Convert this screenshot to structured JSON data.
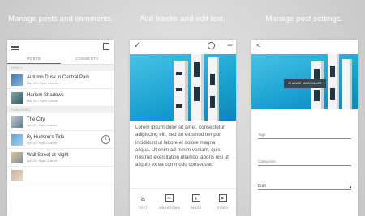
{
  "captions": {
    "left": "Manage posts and comments.",
    "center": "Add blocks and edit text.",
    "right": "Manage post settings."
  },
  "posts_screen": {
    "tabs": [
      "POSTS",
      "COMMENTS"
    ],
    "active_tab": "POSTS",
    "sections": {
      "draft": "DRAFT",
      "published": "PUBLISHED"
    },
    "drafts": [
      {
        "title": "Autumn Dusk in Central Park",
        "meta": "May 26 • Ryan Gushiel"
      },
      {
        "title": "Harlem Shadows",
        "meta": "May 26 • Ryan Gushiel"
      }
    ],
    "published": [
      {
        "title": "The City",
        "meta": "Apr 10 • Ryan Gushiel"
      },
      {
        "title": "By Hudson's Tide",
        "meta": "Apr 10 • Ryan Gushiel",
        "comments": "1"
      },
      {
        "title": "Wall Street at Night",
        "meta": "Apr 10 • Ryan Gushiel"
      },
      {
        "title": "",
        "meta": ""
      }
    ]
  },
  "editor_screen": {
    "body_text": "Lorem ipsum dolor sit amet, consectetur adipiscing elit, sed do eiusmod tempor incididunt ut labore et dolore magna aliqua. Ut enim ad minim veniam, quis nostrud exercitation ullamco laboris nisi ut aliquip ex ea commodo consequat.",
    "blocks": [
      {
        "label": "TEXT",
        "icon": "text-icon"
      },
      {
        "label": "MARKDOWN",
        "icon": "markdown-icon"
      },
      {
        "label": "IMAGE",
        "icon": "image-icon"
      },
      {
        "label": "VIDEO",
        "icon": "video-icon"
      }
    ]
  },
  "settings_screen": {
    "change_image_button": "CHANGE MAIN IMAGE",
    "fields": {
      "tags_placeholder": "Tags",
      "categories_placeholder": "Categories",
      "status_value": "Draft"
    }
  },
  "colors": {
    "accent_sky": "#1aa1cf",
    "button_dark": "#37474f",
    "caption_text": "#ffffff"
  }
}
